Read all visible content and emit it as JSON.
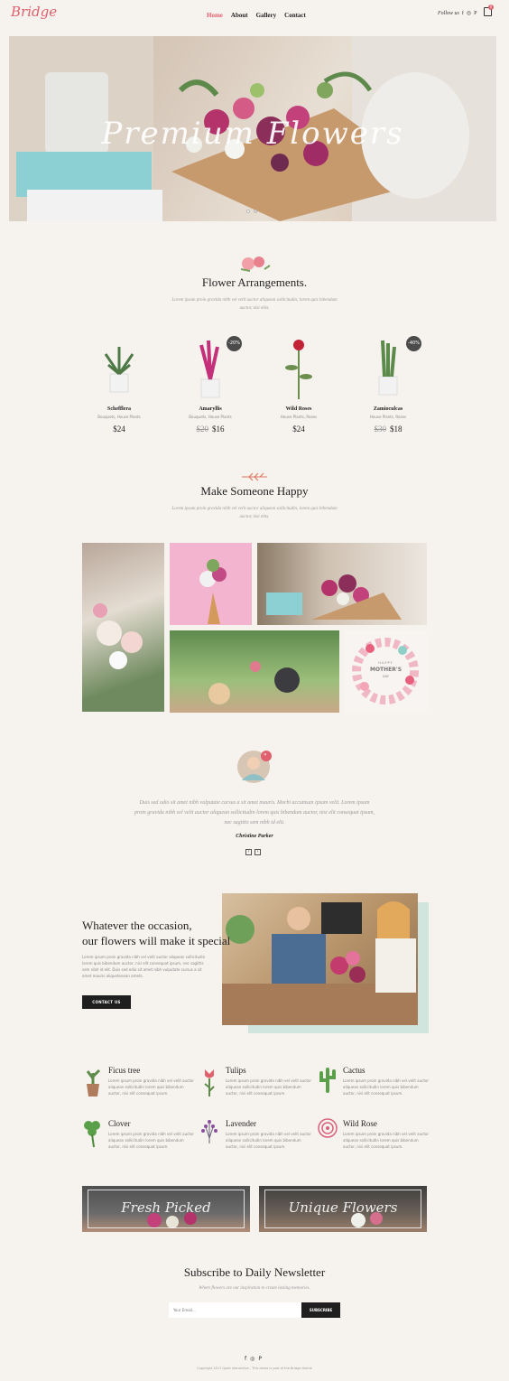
{
  "header": {
    "logo": "Bridge",
    "nav": [
      "Home",
      "About",
      "Gallery",
      "Contact"
    ],
    "follow_label": "Follow us",
    "social": [
      "f",
      "◎",
      "P"
    ],
    "cart_count": "0"
  },
  "hero": {
    "title": "Premium Flowers",
    "slides": 2,
    "active_slide": 1
  },
  "arrangements": {
    "title": "Flower Arrangements.",
    "subtitle": "Lorem ipsum proin gravida nibh vel velit auctor aliquean sollicitudin, lorem quis bibendum auctor, nisi elits.",
    "products": [
      {
        "name": "Schefflera",
        "category": "Bouquets, House Plants",
        "price": "$24",
        "old_price": "",
        "sale": ""
      },
      {
        "name": "Amaryllis",
        "category": "Bouquets, House Plants",
        "price": "$16",
        "old_price": "$20",
        "sale": "-20%"
      },
      {
        "name": "Wild Roses",
        "category": "House Plants, Roses",
        "price": "$24",
        "old_price": "",
        "sale": ""
      },
      {
        "name": "Zamioculcas",
        "category": "House Plants, Roses",
        "price": "$18",
        "old_price": "$30",
        "sale": "-40%"
      }
    ]
  },
  "happy": {
    "title": "Make Someone Happy",
    "subtitle": "Lorem ipsum proin gravida nibh vel velit auctor aliquean sollicitudin, lorem quis bibendum auctor, nisi elits.",
    "mothers_day_top": "HAPPY",
    "mothers_day_main": "MOTHER'S",
    "mothers_day_bottom": "DAY"
  },
  "testimonial": {
    "quote": "Duis sed odio sit amet nibh vulputate cursus a sit amet mauris. Morbi accumsan ipsum velit. Lorem ipsum proin gravida nibh vel velit auctor aliquean sollicitudin lorem quis bibendum auctor, nisi elit consequat ipsum, nec sagittis sem nibh id elit.",
    "author": "Christine Parker",
    "prev": "‹",
    "next": "›"
  },
  "occasion": {
    "title_line1": "Whatever the occasion,",
    "title_line2": "our flowers will make it special",
    "text": "Lorem ipsum proin gravida nibh vel velit auctor aliquean sollicitudin lorem quis bibendum auctor, nisi elit consequat ipsum, nec sagittis sem nibh id elit. Duis sed odio sit amet nibh vulputate cursus a sit amet mauris aliquetenean amets.",
    "button": "CONTACT US"
  },
  "features": [
    {
      "title": "Ficus tree",
      "icon": "potted-plant-icon",
      "text": "Lorem ipsum proin gravida nibh vel velit auctor aliquean sollicitudin lorem quis bibendum auctor, nisi elit consequat ipsum."
    },
    {
      "title": "Tulips",
      "icon": "tulip-icon",
      "text": "Lorem ipsum proin gravida nibh vel velit auctor aliquean sollicitudin lorem quis bibendum auctor, nisi elit consequat ipsum."
    },
    {
      "title": "Cactus",
      "icon": "cactus-icon",
      "text": "Lorem ipsum proin gravida nibh vel velit auctor aliquean sollicitudin lorem quis bibendum auctor, nisi elit consequat ipsum."
    },
    {
      "title": "Clover",
      "icon": "clover-icon",
      "text": "Lorem ipsum proin gravida nibh vel velit auctor aliquean sollicitudin lorem quis bibendum auctor, nisi elit consequat ipsum."
    },
    {
      "title": "Lavender",
      "icon": "lavender-icon",
      "text": "Lorem ipsum proin gravida nibh vel velit auctor aliquean sollicitudin lorem quis bibendum auctor, nisi elit consequat ipsum."
    },
    {
      "title": "Wild Rose",
      "icon": "rose-icon",
      "text": "Lorem ipsum proin gravida nibh vel velit auctor aliquean sollicitudin lorem quis bibendum auctor, nisi elit consequat ipsum."
    }
  ],
  "banners": [
    "Fresh Picked",
    "Unique Flowers"
  ],
  "newsletter": {
    "title": "Subscribe to Daily Newsletter",
    "subtitle": "Where flowers are our inspiration to create lasting memories.",
    "placeholder": "Your Email...",
    "button": "SUBSCRIBE"
  },
  "footer": {
    "social": [
      "f",
      "◎",
      "P"
    ],
    "copyright": "Copyright 2017 Qode Interactive - This demo is part of the Bridge theme"
  },
  "colors": {
    "accent": "#e0606e",
    "dark": "#1f1f1f",
    "bg": "#f6f3ef"
  }
}
